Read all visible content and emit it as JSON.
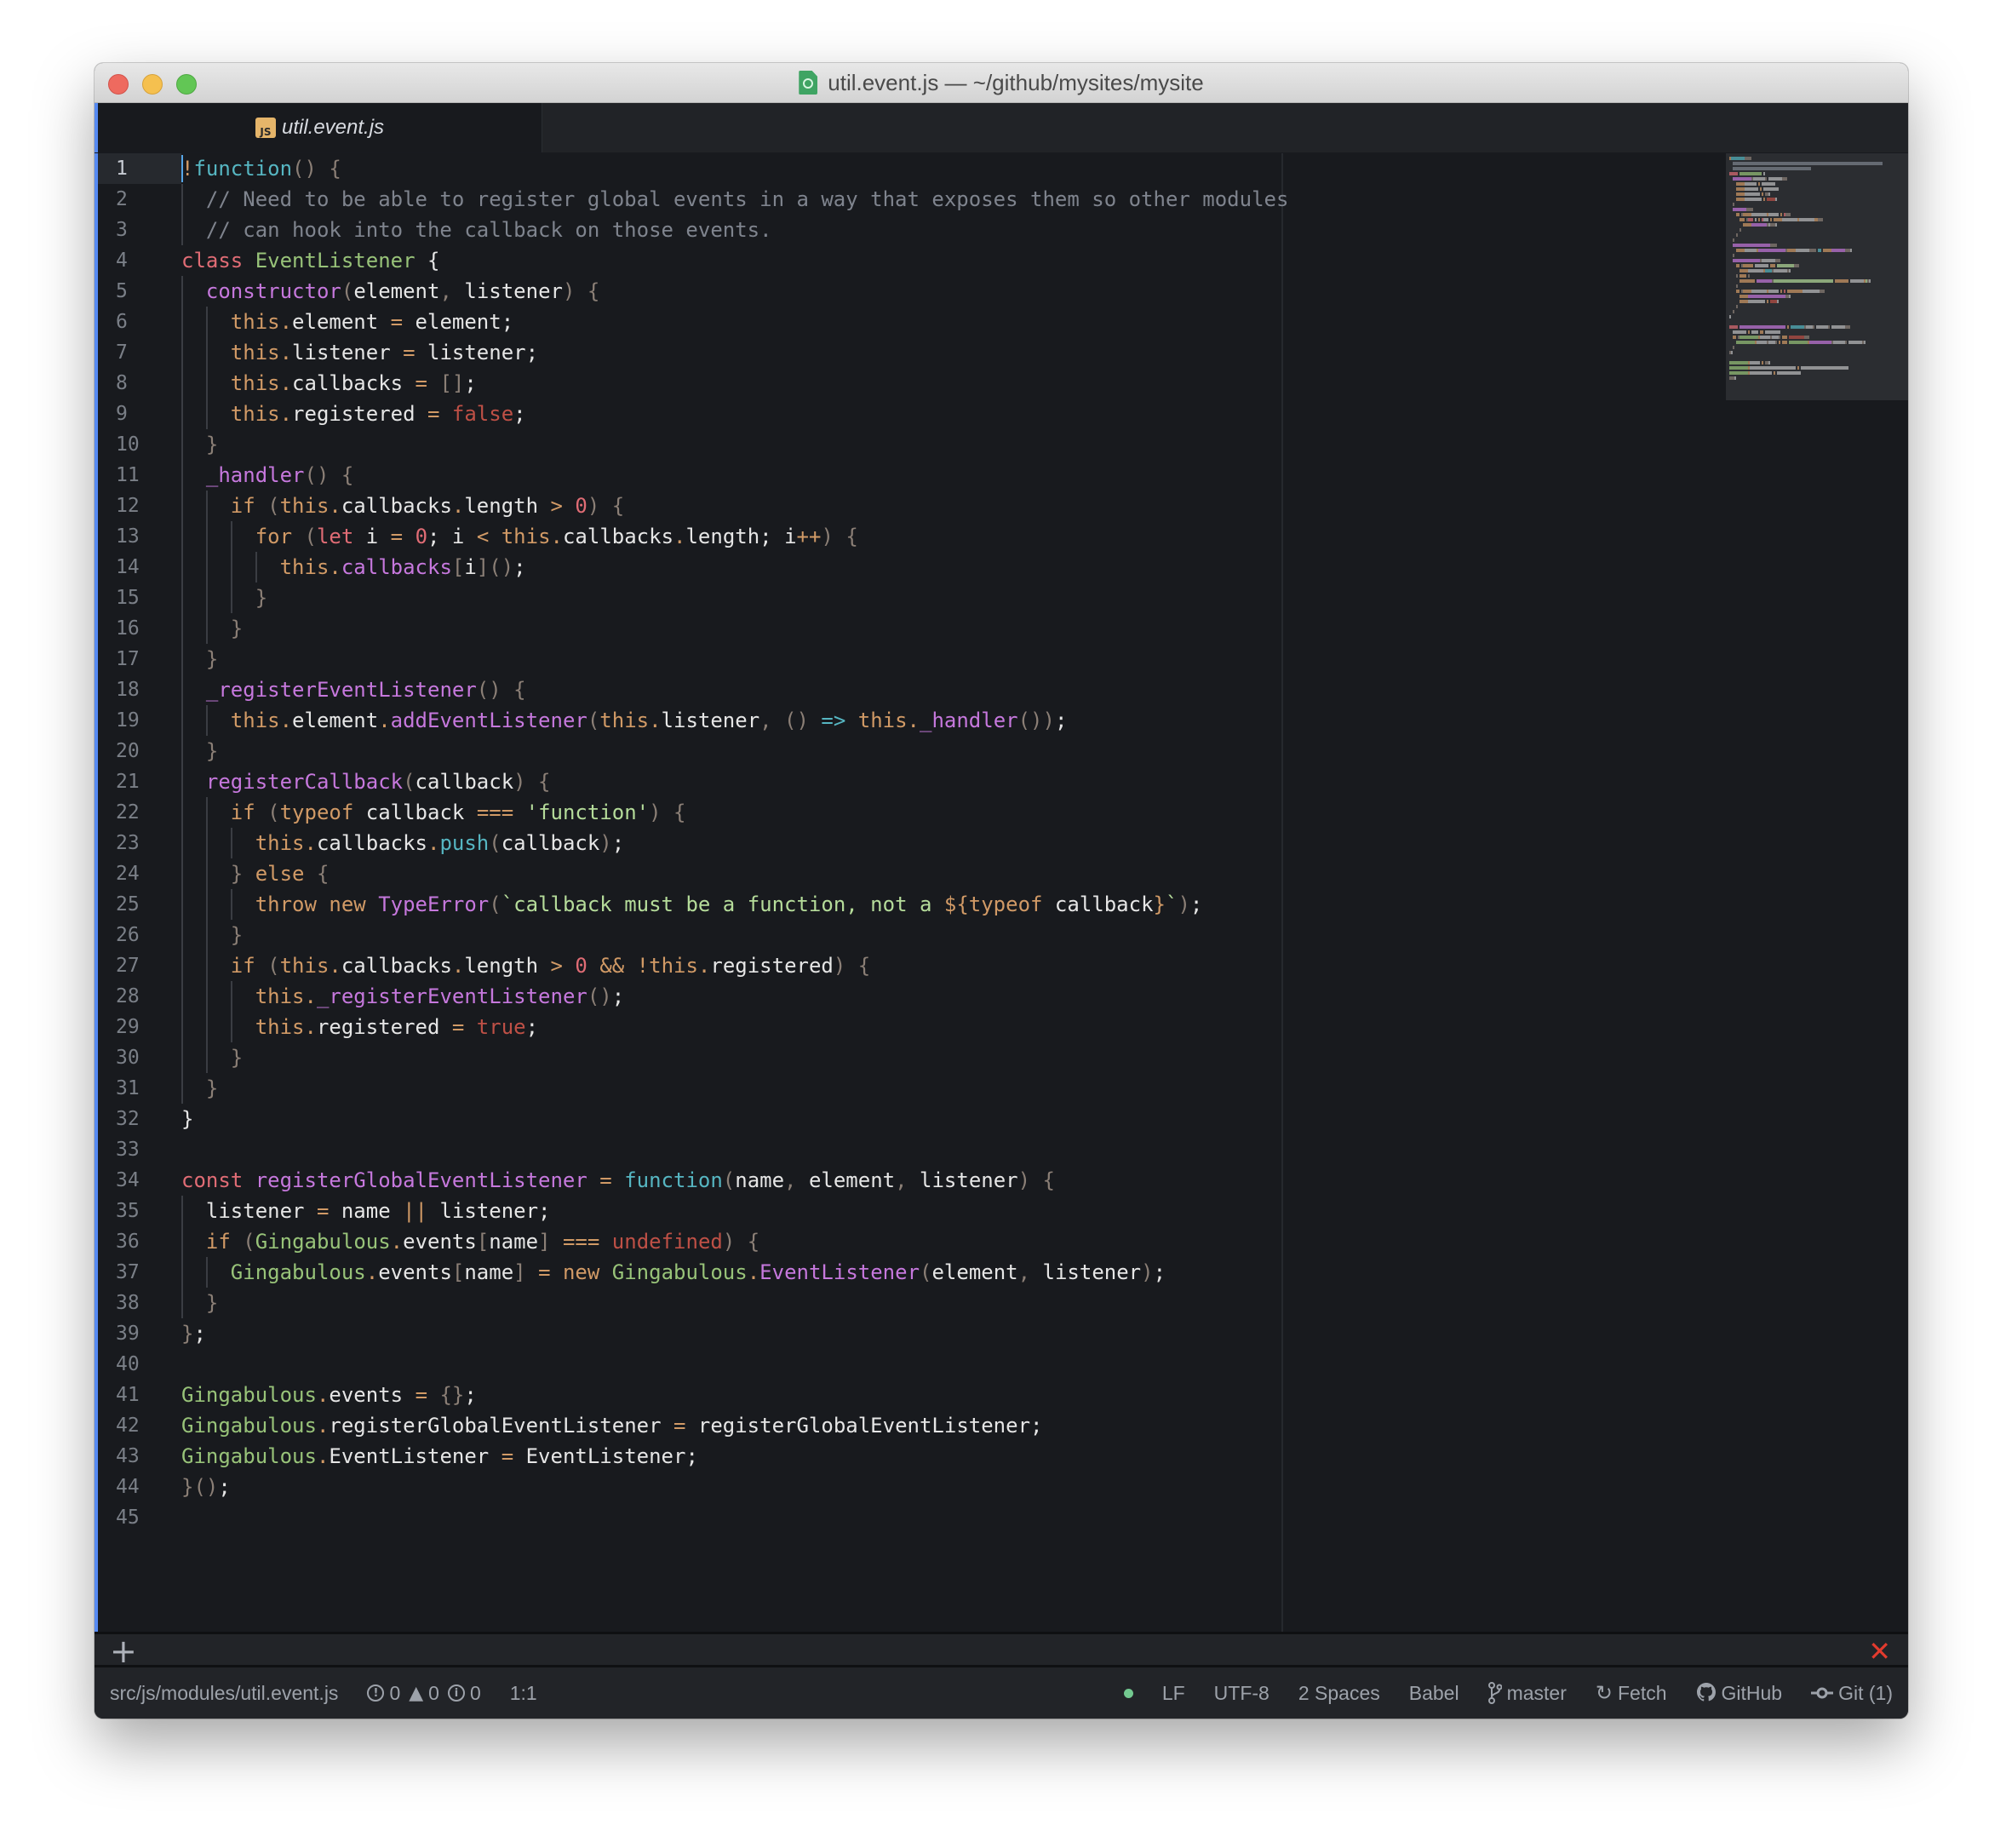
{
  "window": {
    "title": "util.event.js — ~/github/mysites/mysite",
    "title_icon": "atom-file-icon"
  },
  "tabs": [
    {
      "label": "util.event.js",
      "icon": "js-file-icon",
      "icon_text": "JS",
      "active": true
    }
  ],
  "editor": {
    "language": "Babel",
    "cursor_line": 1,
    "lines": [
      [
        [
          "op",
          "!"
        ],
        [
          "fn",
          "function"
        ],
        [
          "pn",
          "() {"
        ]
      ],
      [
        [
          "cm",
          "  // Need to be able to register global events in a way that exposes them so other modules"
        ]
      ],
      [
        [
          "cm",
          "  // can hook into the callback on those events."
        ]
      ],
      [
        [
          "kw",
          "class "
        ],
        [
          "cls",
          "EventListener"
        ],
        [
          "bk",
          " {"
        ]
      ],
      [
        [
          "var",
          "  "
        ],
        [
          "meth",
          "constructor"
        ],
        [
          "pn",
          "("
        ],
        [
          "var",
          "element"
        ],
        [
          "pn",
          ", "
        ],
        [
          "var",
          "listener"
        ],
        [
          "pn",
          ") {"
        ]
      ],
      [
        [
          "var",
          "    "
        ],
        [
          "th",
          "this"
        ],
        [
          "op",
          "."
        ],
        [
          "var",
          "element "
        ],
        [
          "op",
          "="
        ],
        [
          "var",
          " element;"
        ]
      ],
      [
        [
          "var",
          "    "
        ],
        [
          "th",
          "this"
        ],
        [
          "op",
          "."
        ],
        [
          "var",
          "listener "
        ],
        [
          "op",
          "="
        ],
        [
          "var",
          " listener;"
        ]
      ],
      [
        [
          "var",
          "    "
        ],
        [
          "th",
          "this"
        ],
        [
          "op",
          "."
        ],
        [
          "var",
          "callbacks "
        ],
        [
          "op",
          "="
        ],
        [
          "pn",
          " []"
        ],
        [
          "var",
          ";"
        ]
      ],
      [
        [
          "var",
          "    "
        ],
        [
          "th",
          "this"
        ],
        [
          "op",
          "."
        ],
        [
          "var",
          "registered "
        ],
        [
          "op",
          "="
        ],
        [
          "bool",
          " false"
        ],
        [
          "var",
          ";"
        ]
      ],
      [
        [
          "pn",
          "  }"
        ]
      ],
      [
        [
          "var",
          "  "
        ],
        [
          "meth",
          "_handler"
        ],
        [
          "pn",
          "() {"
        ]
      ],
      [
        [
          "var",
          "    "
        ],
        [
          "kw2",
          "if "
        ],
        [
          "pn",
          "("
        ],
        [
          "th",
          "this"
        ],
        [
          "op",
          "."
        ],
        [
          "var",
          "callbacks"
        ],
        [
          "op",
          "."
        ],
        [
          "var",
          "length "
        ],
        [
          "op",
          ">"
        ],
        [
          "num",
          " 0"
        ],
        [
          "pn",
          ") {"
        ]
      ],
      [
        [
          "var",
          "      "
        ],
        [
          "kw2",
          "for "
        ],
        [
          "pn",
          "("
        ],
        [
          "kw",
          "let"
        ],
        [
          "var",
          " i "
        ],
        [
          "op",
          "="
        ],
        [
          "num",
          " 0"
        ],
        [
          "var",
          "; i "
        ],
        [
          "op",
          "<"
        ],
        [
          "th",
          " this"
        ],
        [
          "op",
          "."
        ],
        [
          "var",
          "callbacks"
        ],
        [
          "op",
          "."
        ],
        [
          "var",
          "length; i"
        ],
        [
          "op",
          "++"
        ],
        [
          "pn",
          ") {"
        ]
      ],
      [
        [
          "var",
          "        "
        ],
        [
          "th",
          "this"
        ],
        [
          "op",
          "."
        ],
        [
          "meth",
          "callbacks"
        ],
        [
          "pn",
          "["
        ],
        [
          "var",
          "i"
        ],
        [
          "pn",
          "]()"
        ],
        [
          "var",
          ";"
        ]
      ],
      [
        [
          "pn",
          "      }"
        ]
      ],
      [
        [
          "pn",
          "    }"
        ]
      ],
      [
        [
          "pn",
          "  }"
        ]
      ],
      [
        [
          "var",
          "  "
        ],
        [
          "meth",
          "_registerEventListener"
        ],
        [
          "pn",
          "() {"
        ]
      ],
      [
        [
          "var",
          "    "
        ],
        [
          "th",
          "this"
        ],
        [
          "op",
          "."
        ],
        [
          "var",
          "element"
        ],
        [
          "op",
          "."
        ],
        [
          "meth",
          "addEventListener"
        ],
        [
          "pn",
          "("
        ],
        [
          "th",
          "this"
        ],
        [
          "op",
          "."
        ],
        [
          "var",
          "listener"
        ],
        [
          "pn",
          ", () "
        ],
        [
          "fn",
          "=>"
        ],
        [
          "th",
          " this"
        ],
        [
          "op",
          "."
        ],
        [
          "meth",
          "_handler"
        ],
        [
          "pn",
          "())"
        ],
        [
          "var",
          ";"
        ]
      ],
      [
        [
          "pn",
          "  }"
        ]
      ],
      [
        [
          "var",
          "  "
        ],
        [
          "meth",
          "registerCallback"
        ],
        [
          "pn",
          "("
        ],
        [
          "var",
          "callback"
        ],
        [
          "pn",
          ") {"
        ]
      ],
      [
        [
          "var",
          "    "
        ],
        [
          "kw2",
          "if "
        ],
        [
          "pn",
          "("
        ],
        [
          "kw2",
          "typeof"
        ],
        [
          "var",
          " callback "
        ],
        [
          "op",
          "==="
        ],
        [
          "str",
          " 'function'"
        ],
        [
          "pn",
          ") {"
        ]
      ],
      [
        [
          "var",
          "      "
        ],
        [
          "th",
          "this"
        ],
        [
          "op",
          "."
        ],
        [
          "var",
          "callbacks"
        ],
        [
          "op",
          "."
        ],
        [
          "fn",
          "push"
        ],
        [
          "pn",
          "("
        ],
        [
          "var",
          "callback"
        ],
        [
          "pn",
          ")"
        ],
        [
          "var",
          ";"
        ]
      ],
      [
        [
          "pn",
          "    } "
        ],
        [
          "kw2",
          "else"
        ],
        [
          "pn",
          " {"
        ]
      ],
      [
        [
          "var",
          "      "
        ],
        [
          "kw2",
          "throw new "
        ],
        [
          "meth",
          "TypeError"
        ],
        [
          "pn",
          "("
        ],
        [
          "str",
          "`callback must be a function, not a "
        ],
        [
          "op",
          "${"
        ],
        [
          "kw2",
          "typeof"
        ],
        [
          "var",
          " callback"
        ],
        [
          "op",
          "}"
        ],
        [
          "str",
          "`"
        ],
        [
          "pn",
          ")"
        ],
        [
          "var",
          ";"
        ]
      ],
      [
        [
          "pn",
          "    }"
        ]
      ],
      [
        [
          "var",
          "    "
        ],
        [
          "kw2",
          "if "
        ],
        [
          "pn",
          "("
        ],
        [
          "th",
          "this"
        ],
        [
          "op",
          "."
        ],
        [
          "var",
          "callbacks"
        ],
        [
          "op",
          "."
        ],
        [
          "var",
          "length "
        ],
        [
          "op",
          ">"
        ],
        [
          "num",
          " 0 "
        ],
        [
          "op",
          "&& !"
        ],
        [
          "th",
          "this"
        ],
        [
          "op",
          "."
        ],
        [
          "var",
          "registered"
        ],
        [
          "pn",
          ") {"
        ]
      ],
      [
        [
          "var",
          "      "
        ],
        [
          "th",
          "this"
        ],
        [
          "op",
          "."
        ],
        [
          "meth",
          "_registerEventListener"
        ],
        [
          "pn",
          "()"
        ],
        [
          "var",
          ";"
        ]
      ],
      [
        [
          "var",
          "      "
        ],
        [
          "th",
          "this"
        ],
        [
          "op",
          "."
        ],
        [
          "var",
          "registered "
        ],
        [
          "op",
          "="
        ],
        [
          "bool",
          " true"
        ],
        [
          "var",
          ";"
        ]
      ],
      [
        [
          "pn",
          "    }"
        ]
      ],
      [
        [
          "pn",
          "  }"
        ]
      ],
      [
        [
          "bk",
          "}"
        ]
      ],
      [],
      [
        [
          "kw",
          "const "
        ],
        [
          "meth",
          "registerGlobalEventListener"
        ],
        [
          "op",
          " = "
        ],
        [
          "fn",
          "function"
        ],
        [
          "pn",
          "("
        ],
        [
          "var",
          "name"
        ],
        [
          "pn",
          ", "
        ],
        [
          "var",
          "element"
        ],
        [
          "pn",
          ", "
        ],
        [
          "var",
          "listener"
        ],
        [
          "pn",
          ") {"
        ]
      ],
      [
        [
          "var",
          "  listener "
        ],
        [
          "op",
          "="
        ],
        [
          "var",
          " name "
        ],
        [
          "op",
          "||"
        ],
        [
          "var",
          " listener;"
        ]
      ],
      [
        [
          "var",
          "  "
        ],
        [
          "kw2",
          "if "
        ],
        [
          "pn",
          "("
        ],
        [
          "cls",
          "Gingabulous"
        ],
        [
          "op",
          "."
        ],
        [
          "var",
          "events"
        ],
        [
          "pn",
          "["
        ],
        [
          "var",
          "name"
        ],
        [
          "pn",
          "] "
        ],
        [
          "op",
          "==="
        ],
        [
          "bool",
          " undefined"
        ],
        [
          "pn",
          ") {"
        ]
      ],
      [
        [
          "var",
          "    "
        ],
        [
          "cls",
          "Gingabulous"
        ],
        [
          "op",
          "."
        ],
        [
          "var",
          "events"
        ],
        [
          "pn",
          "["
        ],
        [
          "var",
          "name"
        ],
        [
          "pn",
          "] "
        ],
        [
          "op",
          "="
        ],
        [
          "kw2",
          " new "
        ],
        [
          "cls",
          "Gingabulous"
        ],
        [
          "op",
          "."
        ],
        [
          "meth",
          "EventListener"
        ],
        [
          "pn",
          "("
        ],
        [
          "var",
          "element"
        ],
        [
          "pn",
          ", "
        ],
        [
          "var",
          "listener"
        ],
        [
          "pn",
          ")"
        ],
        [
          "var",
          ";"
        ]
      ],
      [
        [
          "pn",
          "  }"
        ]
      ],
      [
        [
          "pn",
          "}"
        ],
        [
          "var",
          ";"
        ]
      ],
      [],
      [
        [
          "cls",
          "Gingabulous"
        ],
        [
          "op",
          "."
        ],
        [
          "var",
          "events "
        ],
        [
          "op",
          "="
        ],
        [
          "pn",
          " {}"
        ],
        [
          "var",
          ";"
        ]
      ],
      [
        [
          "cls",
          "Gingabulous"
        ],
        [
          "op",
          "."
        ],
        [
          "var",
          "registerGlobalEventListener "
        ],
        [
          "op",
          "="
        ],
        [
          "var",
          " registerGlobalEventListener;"
        ]
      ],
      [
        [
          "cls",
          "Gingabulous"
        ],
        [
          "op",
          "."
        ],
        [
          "var",
          "EventListener "
        ],
        [
          "op",
          "="
        ],
        [
          "var",
          " EventListener;"
        ]
      ],
      [
        [
          "pn",
          "}()"
        ],
        [
          "var",
          ";"
        ]
      ],
      []
    ]
  },
  "panel": {
    "add_icon": "plus-icon",
    "close_icon": "close-x-icon"
  },
  "status_bar": {
    "file_path": "src/js/modules/util.event.js",
    "errors": "0",
    "warnings": "0",
    "infos": "0",
    "cursor_position": "1:1",
    "line_ending": "LF",
    "encoding": "UTF-8",
    "indentation": "2 Spaces",
    "grammar": "Babel",
    "branch": "master",
    "fetch_label": "Fetch",
    "github_label": "GitHub",
    "git_label": "Git (1)",
    "status_dot_color": "#73c990"
  },
  "colors": {
    "accent": "#568af2",
    "error_x": "#e33b2e"
  }
}
